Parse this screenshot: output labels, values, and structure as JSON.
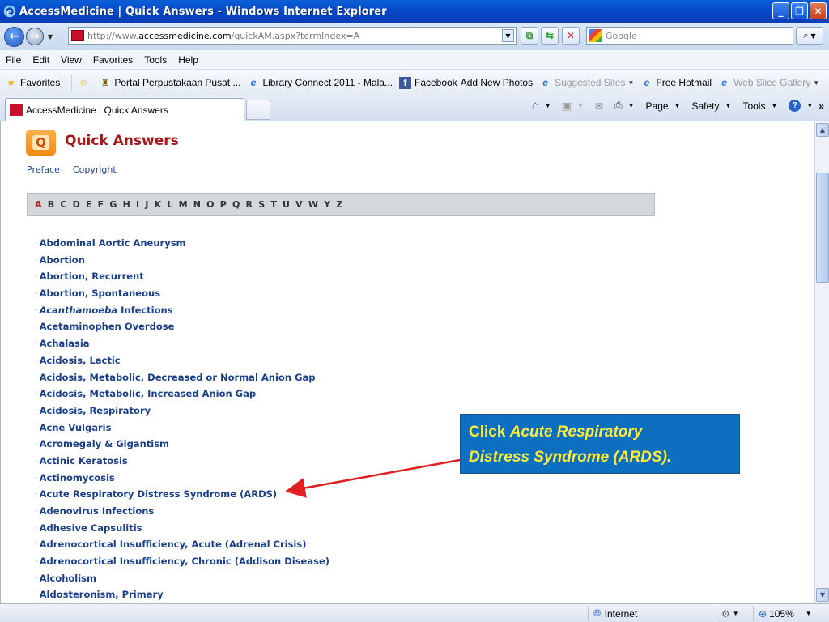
{
  "window": {
    "title": "AccessMedicine | Quick Answers - Windows Internet Explorer"
  },
  "address": {
    "url_prefix": "http://www.",
    "url_domain": "accessmedicine.com",
    "url_path": "/quickAM.aspx?termIndex=A",
    "search_placeholder": "Google"
  },
  "menu": [
    "File",
    "Edit",
    "View",
    "Favorites",
    "Tools",
    "Help"
  ],
  "favorites": {
    "label": "Favorites",
    "items": [
      {
        "label": "Portal Perpustakaan Pusat ...",
        "icon": "portal-icon"
      },
      {
        "label": "Library Connect 2011 - Mala...",
        "icon": "ie-page-icon"
      },
      {
        "label": "Facebook",
        "icon": "facebook-icon"
      },
      {
        "label": "Add New Photos",
        "icon": "none"
      },
      {
        "label": "Suggested Sites",
        "icon": "ie-page-icon",
        "dimmed": true,
        "dropdown": true
      },
      {
        "label": "Free Hotmail",
        "icon": "ie-page-icon"
      },
      {
        "label": "Web Slice Gallery",
        "icon": "ie-page-icon",
        "dimmed": true,
        "dropdown": true
      }
    ]
  },
  "tab": {
    "label": "AccessMedicine | Quick Answers"
  },
  "commands": {
    "page": "Page",
    "safety": "Safety",
    "tools": "Tools"
  },
  "page": {
    "logo_letter": "Q",
    "title": "Quick Answers",
    "links": [
      "Preface",
      "Copyright"
    ],
    "alphabet": [
      "A",
      "B",
      "C",
      "D",
      "E",
      "F",
      "G",
      "H",
      "I",
      "J",
      "K",
      "L",
      "M",
      "N",
      "O",
      "P",
      "Q",
      "R",
      "S",
      "T",
      "U",
      "V",
      "W",
      "Y",
      "Z"
    ],
    "current_letter": "A",
    "terms": [
      "Abdominal Aortic Aneurysm",
      "Abortion",
      "Abortion, Recurrent",
      "Abortion, Spontaneous",
      "Acanthamoeba Infections",
      "Acetaminophen Overdose",
      "Achalasia",
      "Acidosis, Lactic",
      "Acidosis, Metabolic, Decreased or Normal Anion Gap",
      "Acidosis, Metabolic, Increased Anion Gap",
      "Acidosis, Respiratory",
      "Acne Vulgaris",
      "Acromegaly & Gigantism",
      "Actinic Keratosis",
      "Actinomycosis",
      "Acute Respiratory Distress Syndrome (ARDS)",
      "Adenovirus Infections",
      "Adhesive Capsulitis",
      "Adrenocortical Insufficiency, Acute (Adrenal Crisis)",
      "Adrenocortical Insufficiency, Chronic (Addison Disease)",
      "Alcoholism",
      "Aldosteronism, Primary"
    ]
  },
  "callout": {
    "line1_plain": "Click ",
    "line1_italic": "Acute Respiratory",
    "line2_italic": "Distress Syndrome (ARDS)."
  },
  "status": {
    "zone": "Internet",
    "zoom": "105%"
  },
  "colors": {
    "title_red": "#a11a1a",
    "link_blue": "#1a3f8a",
    "callout_bg": "#0c6fc0",
    "callout_text": "#ffeb3b",
    "arrow": "#e02020"
  }
}
